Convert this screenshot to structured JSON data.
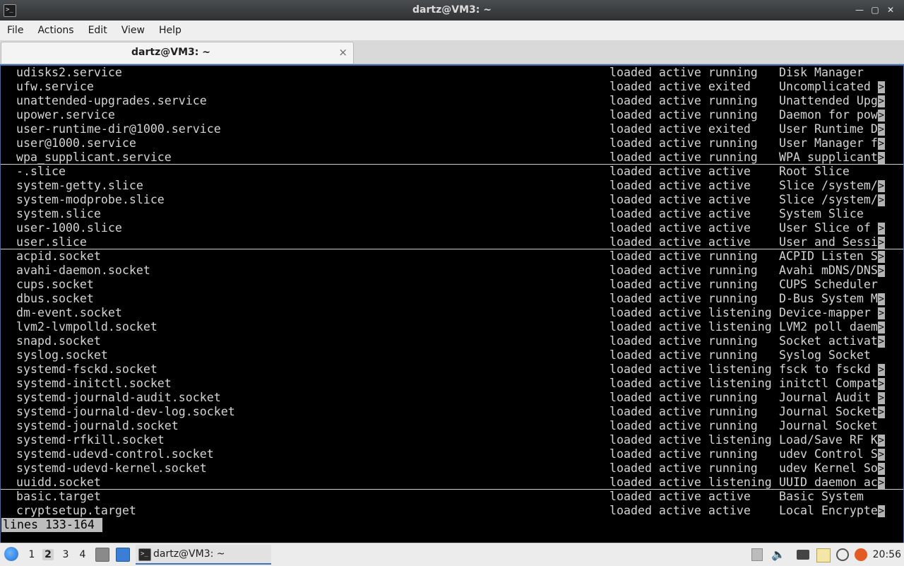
{
  "window": {
    "title": "dartz@VM3: ~",
    "controls": [
      "minimize-icon",
      "maximize-icon",
      "close-icon"
    ]
  },
  "menu": [
    "File",
    "Actions",
    "Edit",
    "View",
    "Help"
  ],
  "tab": {
    "label": "dartz@VM3: ~",
    "close": "×"
  },
  "terminal": {
    "lines": [
      {
        "unit": "udisks2.service",
        "state": "loaded active running",
        "desc": "Disk Manager",
        "trunc": false,
        "sep": false
      },
      {
        "unit": "ufw.service",
        "state": "loaded active exited",
        "desc": "Uncomplicated",
        "trunc": true,
        "sep": false
      },
      {
        "unit": "unattended-upgrades.service",
        "state": "loaded active running",
        "desc": "Unattended Upg",
        "trunc": true,
        "sep": false
      },
      {
        "unit": "upower.service",
        "state": "loaded active running",
        "desc": "Daemon for pow",
        "trunc": true,
        "sep": false
      },
      {
        "unit": "user-runtime-dir@1000.service",
        "state": "loaded active exited",
        "desc": "User Runtime D",
        "trunc": true,
        "sep": false
      },
      {
        "unit": "user@1000.service",
        "state": "loaded active running",
        "desc": "User Manager f",
        "trunc": true,
        "sep": false
      },
      {
        "unit": "wpa_supplicant.service",
        "state": "loaded active running",
        "desc": "WPA supplicant",
        "trunc": true,
        "sep": true
      },
      {
        "unit": "-.slice",
        "state": "loaded active active",
        "desc": "Root Slice",
        "trunc": false,
        "sep": false
      },
      {
        "unit": "system-getty.slice",
        "state": "loaded active active",
        "desc": "Slice /system/",
        "trunc": true,
        "sep": false
      },
      {
        "unit": "system-modprobe.slice",
        "state": "loaded active active",
        "desc": "Slice /system/",
        "trunc": true,
        "sep": false
      },
      {
        "unit": "system.slice",
        "state": "loaded active active",
        "desc": "System Slice",
        "trunc": false,
        "sep": false
      },
      {
        "unit": "user-1000.slice",
        "state": "loaded active active",
        "desc": "User Slice of",
        "trunc": true,
        "sep": false
      },
      {
        "unit": "user.slice",
        "state": "loaded active active",
        "desc": "User and Sessi",
        "trunc": true,
        "sep": true
      },
      {
        "unit": "acpid.socket",
        "state": "loaded active running",
        "desc": "ACPID Listen S",
        "trunc": true,
        "sep": false
      },
      {
        "unit": "avahi-daemon.socket",
        "state": "loaded active running",
        "desc": "Avahi mDNS/DNS",
        "trunc": true,
        "sep": false
      },
      {
        "unit": "cups.socket",
        "state": "loaded active running",
        "desc": "CUPS Scheduler",
        "trunc": false,
        "sep": false
      },
      {
        "unit": "dbus.socket",
        "state": "loaded active running",
        "desc": "D-Bus System M",
        "trunc": true,
        "sep": false
      },
      {
        "unit": "dm-event.socket",
        "state": "loaded active listening",
        "desc": "Device-mapper",
        "trunc": true,
        "sep": false
      },
      {
        "unit": "lvm2-lvmpolld.socket",
        "state": "loaded active listening",
        "desc": "LVM2 poll daem",
        "trunc": true,
        "sep": false
      },
      {
        "unit": "snapd.socket",
        "state": "loaded active running",
        "desc": "Socket activat",
        "trunc": true,
        "sep": false
      },
      {
        "unit": "syslog.socket",
        "state": "loaded active running",
        "desc": "Syslog Socket",
        "trunc": false,
        "sep": false
      },
      {
        "unit": "systemd-fsckd.socket",
        "state": "loaded active listening",
        "desc": "fsck to fsckd",
        "trunc": true,
        "sep": false
      },
      {
        "unit": "systemd-initctl.socket",
        "state": "loaded active listening",
        "desc": "initctl Compat",
        "trunc": true,
        "sep": false
      },
      {
        "unit": "systemd-journald-audit.socket",
        "state": "loaded active running",
        "desc": "Journal Audit",
        "trunc": true,
        "sep": false
      },
      {
        "unit": "systemd-journald-dev-log.socket",
        "state": "loaded active running",
        "desc": "Journal Socket",
        "trunc": true,
        "sep": false
      },
      {
        "unit": "systemd-journald.socket",
        "state": "loaded active running",
        "desc": "Journal Socket",
        "trunc": false,
        "sep": false
      },
      {
        "unit": "systemd-rfkill.socket",
        "state": "loaded active listening",
        "desc": "Load/Save RF K",
        "trunc": true,
        "sep": false
      },
      {
        "unit": "systemd-udevd-control.socket",
        "state": "loaded active running",
        "desc": "udev Control S",
        "trunc": true,
        "sep": false
      },
      {
        "unit": "systemd-udevd-kernel.socket",
        "state": "loaded active running",
        "desc": "udev Kernel So",
        "trunc": true,
        "sep": false
      },
      {
        "unit": "uuidd.socket",
        "state": "loaded active listening",
        "desc": "UUID daemon ac",
        "trunc": true,
        "sep": true
      },
      {
        "unit": "basic.target",
        "state": "loaded active active",
        "desc": "Basic System",
        "trunc": false,
        "sep": false
      },
      {
        "unit": "cryptsetup.target",
        "state": "loaded active active",
        "desc": "Local Encrypte",
        "trunc": true,
        "sep": false
      }
    ],
    "truncate_marker": ">",
    "pager_status": "lines 133-164"
  },
  "taskbar": {
    "workspaces": [
      "1",
      "2",
      "3",
      "4"
    ],
    "active_workspace": "2",
    "task_label": "dartz@VM3: ~",
    "clock": "20:56",
    "tray_icons": [
      "network-icon",
      "volume-icon",
      "keyboard-icon",
      "clipboard-icon",
      "update-icon",
      "power-icon"
    ]
  }
}
